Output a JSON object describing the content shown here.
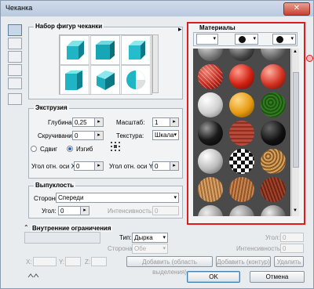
{
  "window": {
    "title": "Чеканка"
  },
  "shapes_section": {
    "label": "Набор фигур чеканки"
  },
  "extrusion": {
    "label": "Экструзия",
    "depth_label": "Глубина:",
    "depth_value": "0,25",
    "scale_label": "Масштаб:",
    "scale_value": "1",
    "twist_label": "Скручивание:",
    "twist_value": "0",
    "texture_label": "Текстура:",
    "texture_value": "Шкала",
    "shift_label": "Сдвиг",
    "bend_label": "Изгиб",
    "x_angle_label": "Угол отн. оси X:",
    "x_angle_value": "0",
    "y_angle_label": "Угол отн. оси Y:",
    "y_angle_value": "0"
  },
  "bulge": {
    "label": "Выпуклость",
    "sides_label": "Стороны:",
    "sides_value": "Спереди",
    "angle_label": "Угол:",
    "angle_value": "0",
    "intensity_label": "Интенсивность:",
    "intensity_value": "0"
  },
  "inner_constraints": {
    "label": "Внутренние ограничения",
    "type_label": "Тип:",
    "type_value": "Дырка",
    "side_label": "Сторона:",
    "side_value": "Обе",
    "angle_label": "Угол:",
    "angle_value": "0",
    "intensity_label": "Интенсивность:",
    "intensity_value": "0",
    "x_label": "X:",
    "y_label": "Y:",
    "z_label": "Z:",
    "add_selection_label": "Добавить (область выделения)",
    "add_contour_label": "Добавить (контур)",
    "delete_label": "Удалить"
  },
  "materials": {
    "label": "Материалы"
  },
  "buttons": {
    "ok": "OK",
    "cancel": "Отмена",
    "close": "✕"
  },
  "colors": {
    "highlight": "#e01b1b",
    "shape_cyan": "#1fb5c4"
  },
  "icons": {
    "expand": "▸",
    "radio_checked": "bend",
    "scroll_up": "▲",
    "scroll_down": "▼"
  }
}
